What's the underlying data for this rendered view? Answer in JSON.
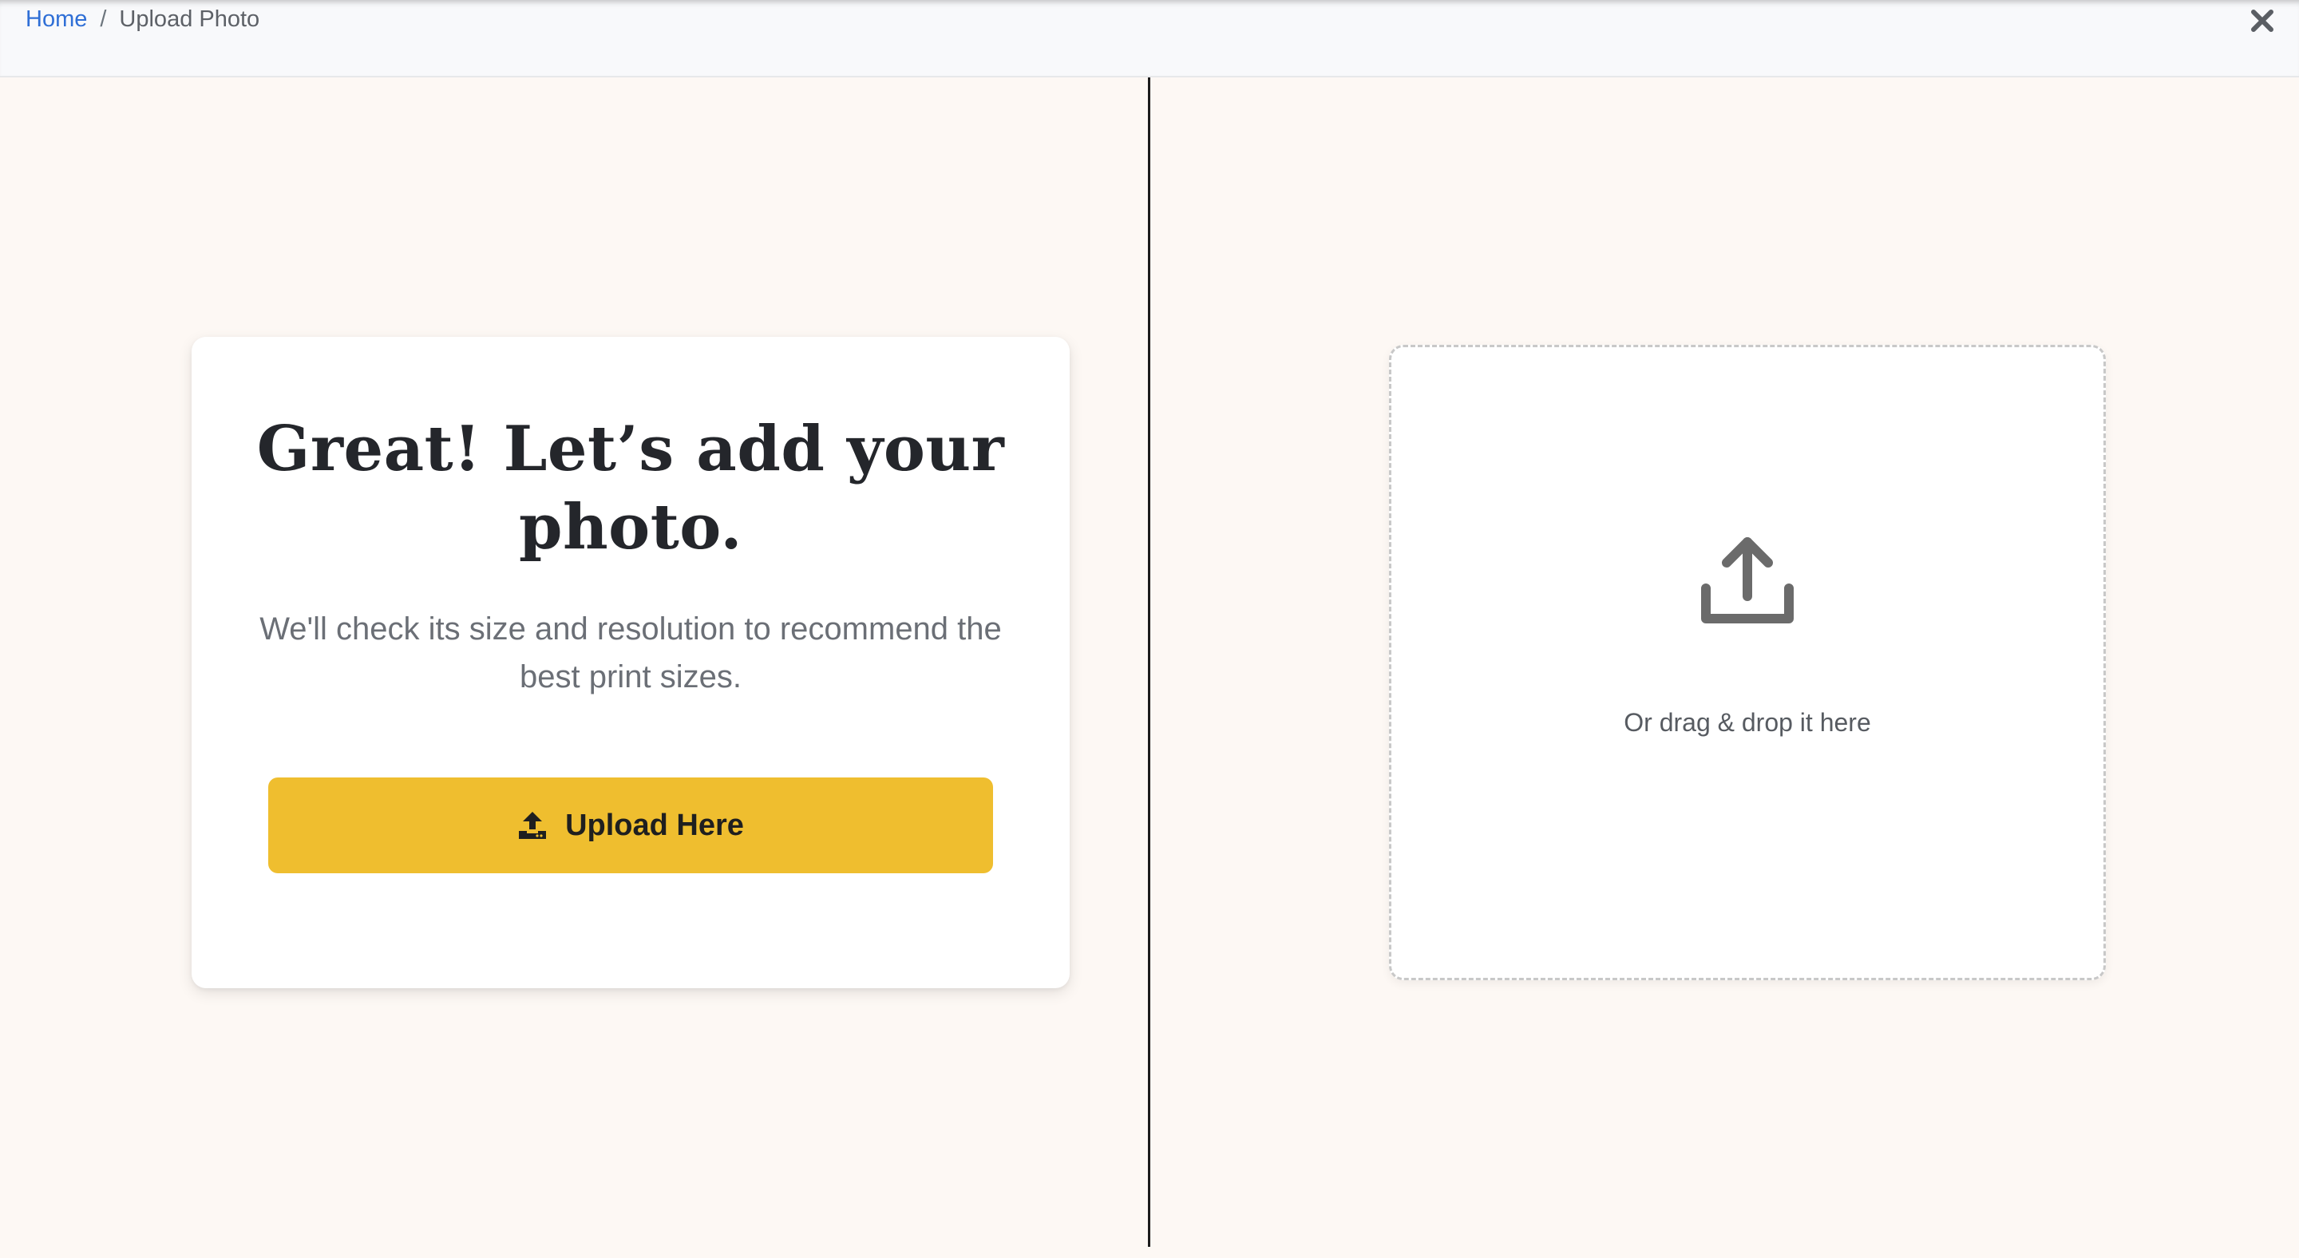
{
  "breadcrumb": {
    "home": "Home",
    "separator": "/",
    "current": "Upload Photo"
  },
  "header": {
    "close_icon": "close-icon"
  },
  "card": {
    "title": "Great! Let’s add your photo.",
    "subtitle": "We'll check its size and resolution to recommend the best print sizes.",
    "button_label": "Upload Here",
    "button_icon": "upload-icon"
  },
  "dropzone": {
    "icon": "upload-arrow-icon",
    "text": "Or drag & drop it here"
  },
  "colors": {
    "accent": "#efbe2f",
    "link": "#2f6fd6",
    "background": "#fdf8f4"
  }
}
